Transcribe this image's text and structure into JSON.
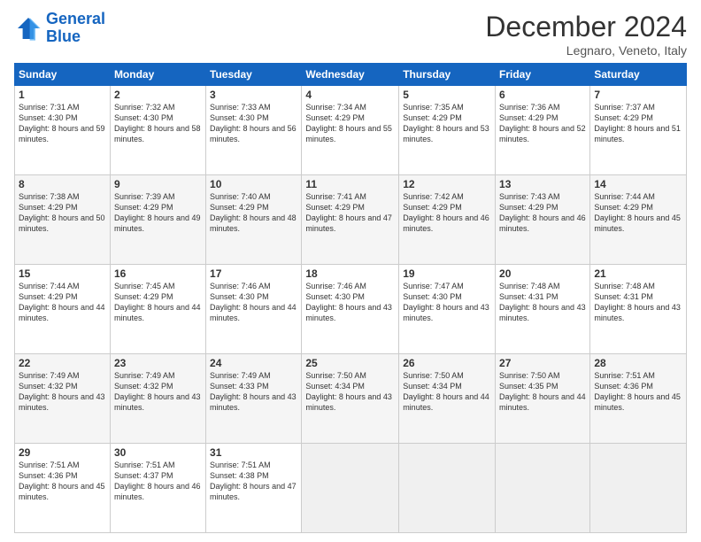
{
  "logo": {
    "line1": "General",
    "line2": "Blue"
  },
  "title": "December 2024",
  "location": "Legnaro, Veneto, Italy",
  "header_days": [
    "Sunday",
    "Monday",
    "Tuesday",
    "Wednesday",
    "Thursday",
    "Friday",
    "Saturday"
  ],
  "weeks": [
    [
      {
        "day": "1",
        "sunrise": "Sunrise: 7:31 AM",
        "sunset": "Sunset: 4:30 PM",
        "daylight": "Daylight: 8 hours and 59 minutes."
      },
      {
        "day": "2",
        "sunrise": "Sunrise: 7:32 AM",
        "sunset": "Sunset: 4:30 PM",
        "daylight": "Daylight: 8 hours and 58 minutes."
      },
      {
        "day": "3",
        "sunrise": "Sunrise: 7:33 AM",
        "sunset": "Sunset: 4:30 PM",
        "daylight": "Daylight: 8 hours and 56 minutes."
      },
      {
        "day": "4",
        "sunrise": "Sunrise: 7:34 AM",
        "sunset": "Sunset: 4:29 PM",
        "daylight": "Daylight: 8 hours and 55 minutes."
      },
      {
        "day": "5",
        "sunrise": "Sunrise: 7:35 AM",
        "sunset": "Sunset: 4:29 PM",
        "daylight": "Daylight: 8 hours and 53 minutes."
      },
      {
        "day": "6",
        "sunrise": "Sunrise: 7:36 AM",
        "sunset": "Sunset: 4:29 PM",
        "daylight": "Daylight: 8 hours and 52 minutes."
      },
      {
        "day": "7",
        "sunrise": "Sunrise: 7:37 AM",
        "sunset": "Sunset: 4:29 PM",
        "daylight": "Daylight: 8 hours and 51 minutes."
      }
    ],
    [
      {
        "day": "8",
        "sunrise": "Sunrise: 7:38 AM",
        "sunset": "Sunset: 4:29 PM",
        "daylight": "Daylight: 8 hours and 50 minutes."
      },
      {
        "day": "9",
        "sunrise": "Sunrise: 7:39 AM",
        "sunset": "Sunset: 4:29 PM",
        "daylight": "Daylight: 8 hours and 49 minutes."
      },
      {
        "day": "10",
        "sunrise": "Sunrise: 7:40 AM",
        "sunset": "Sunset: 4:29 PM",
        "daylight": "Daylight: 8 hours and 48 minutes."
      },
      {
        "day": "11",
        "sunrise": "Sunrise: 7:41 AM",
        "sunset": "Sunset: 4:29 PM",
        "daylight": "Daylight: 8 hours and 47 minutes."
      },
      {
        "day": "12",
        "sunrise": "Sunrise: 7:42 AM",
        "sunset": "Sunset: 4:29 PM",
        "daylight": "Daylight: 8 hours and 46 minutes."
      },
      {
        "day": "13",
        "sunrise": "Sunrise: 7:43 AM",
        "sunset": "Sunset: 4:29 PM",
        "daylight": "Daylight: 8 hours and 46 minutes."
      },
      {
        "day": "14",
        "sunrise": "Sunrise: 7:44 AM",
        "sunset": "Sunset: 4:29 PM",
        "daylight": "Daylight: 8 hours and 45 minutes."
      }
    ],
    [
      {
        "day": "15",
        "sunrise": "Sunrise: 7:44 AM",
        "sunset": "Sunset: 4:29 PM",
        "daylight": "Daylight: 8 hours and 44 minutes."
      },
      {
        "day": "16",
        "sunrise": "Sunrise: 7:45 AM",
        "sunset": "Sunset: 4:29 PM",
        "daylight": "Daylight: 8 hours and 44 minutes."
      },
      {
        "day": "17",
        "sunrise": "Sunrise: 7:46 AM",
        "sunset": "Sunset: 4:30 PM",
        "daylight": "Daylight: 8 hours and 44 minutes."
      },
      {
        "day": "18",
        "sunrise": "Sunrise: 7:46 AM",
        "sunset": "Sunset: 4:30 PM",
        "daylight": "Daylight: 8 hours and 43 minutes."
      },
      {
        "day": "19",
        "sunrise": "Sunrise: 7:47 AM",
        "sunset": "Sunset: 4:30 PM",
        "daylight": "Daylight: 8 hours and 43 minutes."
      },
      {
        "day": "20",
        "sunrise": "Sunrise: 7:48 AM",
        "sunset": "Sunset: 4:31 PM",
        "daylight": "Daylight: 8 hours and 43 minutes."
      },
      {
        "day": "21",
        "sunrise": "Sunrise: 7:48 AM",
        "sunset": "Sunset: 4:31 PM",
        "daylight": "Daylight: 8 hours and 43 minutes."
      }
    ],
    [
      {
        "day": "22",
        "sunrise": "Sunrise: 7:49 AM",
        "sunset": "Sunset: 4:32 PM",
        "daylight": "Daylight: 8 hours and 43 minutes."
      },
      {
        "day": "23",
        "sunrise": "Sunrise: 7:49 AM",
        "sunset": "Sunset: 4:32 PM",
        "daylight": "Daylight: 8 hours and 43 minutes."
      },
      {
        "day": "24",
        "sunrise": "Sunrise: 7:49 AM",
        "sunset": "Sunset: 4:33 PM",
        "daylight": "Daylight: 8 hours and 43 minutes."
      },
      {
        "day": "25",
        "sunrise": "Sunrise: 7:50 AM",
        "sunset": "Sunset: 4:34 PM",
        "daylight": "Daylight: 8 hours and 43 minutes."
      },
      {
        "day": "26",
        "sunrise": "Sunrise: 7:50 AM",
        "sunset": "Sunset: 4:34 PM",
        "daylight": "Daylight: 8 hours and 44 minutes."
      },
      {
        "day": "27",
        "sunrise": "Sunrise: 7:50 AM",
        "sunset": "Sunset: 4:35 PM",
        "daylight": "Daylight: 8 hours and 44 minutes."
      },
      {
        "day": "28",
        "sunrise": "Sunrise: 7:51 AM",
        "sunset": "Sunset: 4:36 PM",
        "daylight": "Daylight: 8 hours and 45 minutes."
      }
    ],
    [
      {
        "day": "29",
        "sunrise": "Sunrise: 7:51 AM",
        "sunset": "Sunset: 4:36 PM",
        "daylight": "Daylight: 8 hours and 45 minutes."
      },
      {
        "day": "30",
        "sunrise": "Sunrise: 7:51 AM",
        "sunset": "Sunset: 4:37 PM",
        "daylight": "Daylight: 8 hours and 46 minutes."
      },
      {
        "day": "31",
        "sunrise": "Sunrise: 7:51 AM",
        "sunset": "Sunset: 4:38 PM",
        "daylight": "Daylight: 8 hours and 47 minutes."
      },
      null,
      null,
      null,
      null
    ]
  ]
}
